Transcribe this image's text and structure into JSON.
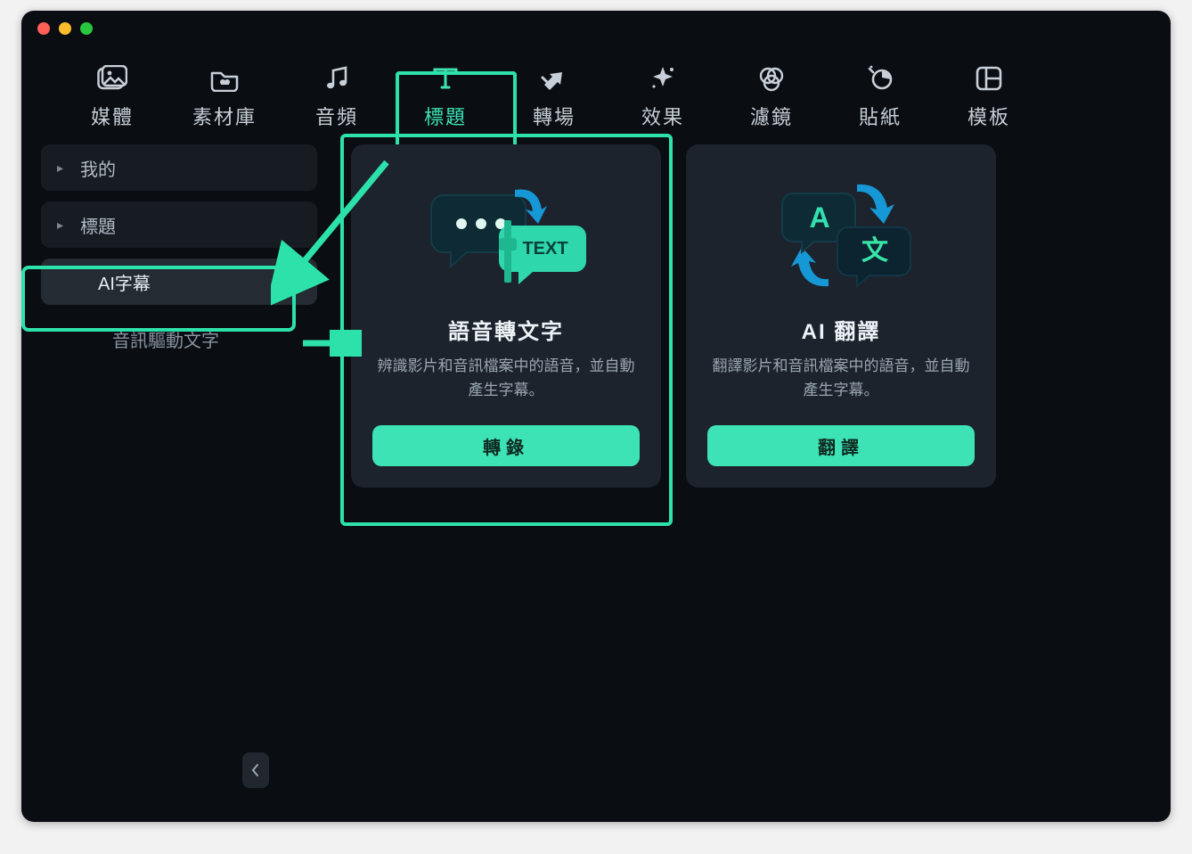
{
  "tabs": [
    {
      "id": "media",
      "label": "媒體"
    },
    {
      "id": "stock",
      "label": "素材庫"
    },
    {
      "id": "audio",
      "label": "音頻"
    },
    {
      "id": "title",
      "label": "標題",
      "active": true
    },
    {
      "id": "transition",
      "label": "轉場"
    },
    {
      "id": "effect",
      "label": "效果"
    },
    {
      "id": "filter",
      "label": "濾鏡"
    },
    {
      "id": "sticker",
      "label": "貼紙"
    },
    {
      "id": "template",
      "label": "模板"
    }
  ],
  "sidebar": {
    "items": [
      {
        "id": "mine",
        "label": "我的",
        "caret": true
      },
      {
        "id": "titles",
        "label": "標題",
        "caret": true
      },
      {
        "id": "ai-subtitle",
        "label": "AI字幕",
        "selected": true,
        "indent": true
      },
      {
        "id": "audio-driven",
        "label": "音訊驅動文字",
        "plain": true,
        "indent": true
      }
    ]
  },
  "cards": {
    "stt": {
      "title": "語音轉文字",
      "desc": "辨識影片和音訊檔案中的語音，並自動產生字幕。",
      "button": "轉錄"
    },
    "translate": {
      "title": "AI 翻譯",
      "desc": "翻譯影片和音訊檔案中的語音，並自動產生字幕。",
      "button": "翻譯"
    }
  },
  "colors": {
    "accent": "#3de3b4",
    "highlight": "#2ce2aa"
  }
}
